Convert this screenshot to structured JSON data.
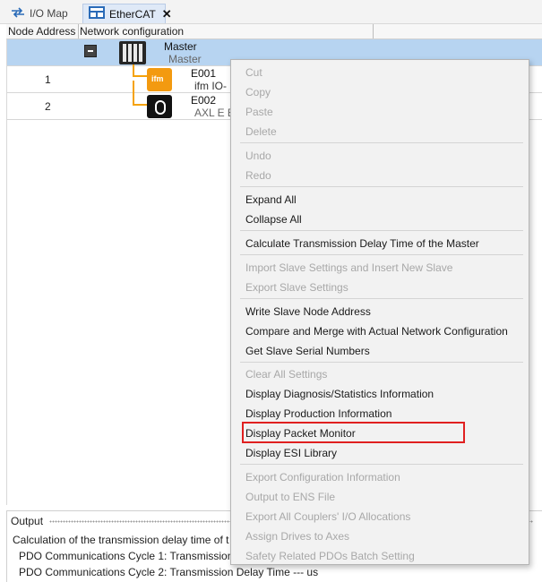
{
  "tabs": [
    {
      "label": "I/O Map",
      "icon": "arrows-swap-icon"
    },
    {
      "label": "EtherCAT",
      "icon": "ethercat-icon",
      "close": "✕"
    }
  ],
  "columns": {
    "node_address": "Node Address",
    "network_configuration": "Network configuration"
  },
  "tree": {
    "master": {
      "name": "Master",
      "subtitle": "Master"
    },
    "slaves": [
      {
        "address": "1",
        "name": "E001",
        "subtitle": "ifm IO-"
      },
      {
        "address": "2",
        "name": "E002",
        "subtitle": "AXL E E"
      }
    ]
  },
  "context_menu": {
    "cut": "Cut",
    "copy": "Copy",
    "paste": "Paste",
    "delete": "Delete",
    "undo": "Undo",
    "redo": "Redo",
    "expand_all": "Expand All",
    "collapse_all": "Collapse All",
    "calc_delay": "Calculate Transmission Delay Time of the Master",
    "import_slave": "Import Slave Settings and Insert New Slave",
    "export_slave": "Export Slave Settings",
    "write_node_address": "Write Slave Node Address",
    "compare_merge": "Compare and Merge with Actual Network Configuration",
    "get_serials": "Get Slave Serial Numbers",
    "clear_all": "Clear All Settings",
    "display_diag": "Display Diagnosis/Statistics Information",
    "display_production": "Display Production Information",
    "display_packet_monitor": "Display Packet Monitor",
    "display_esi": "Display ESI Library",
    "export_config": "Export Configuration Information",
    "output_ens": "Output to ENS File",
    "export_couplers": "Export All Couplers' I/O Allocations",
    "assign_drives": "Assign Drives to Axes",
    "safety_pdo": "Safety Related PDOs Batch Setting"
  },
  "output": {
    "title": "Output",
    "lines": [
      "Calculation of the transmission delay time of t",
      "PDO Communications Cycle 1: Transmission",
      "PDO Communications Cycle 2: Transmission Delay Time --- us"
    ]
  },
  "colors": {
    "selected_row": "#b7d4f1",
    "connector": "#f5a20a",
    "highlight": "#e02020",
    "disabled_text": "#a8a8a8"
  }
}
